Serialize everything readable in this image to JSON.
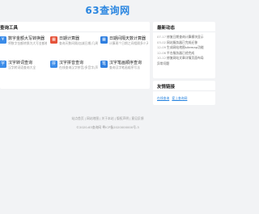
{
  "header": {
    "logo": "63查询网"
  },
  "tools": {
    "title": "查询工具",
    "items": [
      {
        "name": "数字金额大写转换器",
        "desc": "将数字金额转换为大写金额格式",
        "icon": "yuan-icon",
        "icon_char": "¥",
        "color": "#3a8be8"
      },
      {
        "name": "日期计算器",
        "desc": "查询天数间隔/加减日期/几周几",
        "icon": "calendar-icon",
        "icon_char": "▦",
        "color": "#e5533a"
      },
      {
        "name": "日期间隔天数计算器",
        "desc": "计算两个日期之间相隔多少天",
        "icon": "calendar-icon",
        "icon_char": "▦",
        "color": "#2f7fe0"
      },
      {
        "name": "汉字转词查询",
        "desc": "汉字转词语查询大全",
        "icon": "hanzi-icon",
        "icon_char": "字",
        "color": "#3a8be8"
      },
      {
        "name": "汉字拼音查询",
        "desc": "在线查询汉字拼音/多音字/声调大全",
        "icon": "pinyin-icon",
        "icon_char": "拼",
        "color": "#3a8be8"
      },
      {
        "name": "汉字笔画顺序查询",
        "desc": "查询汉字笔画顺序写法",
        "icon": "strokes-icon",
        "icon_char": "笔",
        "color": "#2f7fe0"
      }
    ]
  },
  "news": {
    "title": "最新动态",
    "items": [
      {
        "date": "07-17",
        "text": "修复日期查询计算模块显示"
      },
      {
        "date": "03-02",
        "text": "网站服务器已完成迁移"
      },
      {
        "date": "12-09",
        "text": "生成网站地图sitemap功能"
      },
      {
        "date": "12-06",
        "text": "平台服务器已经完成"
      },
      {
        "date": "10-12",
        "text": "修复网站文章详情页面布局"
      },
      {
        "date": "",
        "text": "异常问题"
      }
    ]
  },
  "friend_links": {
    "title": "友情链接",
    "items": [
      "在线查询",
      "爱上查询网"
    ]
  },
  "footer": {
    "links": [
      "站点首页",
      "网站地图",
      "关于本站",
      "版权声明",
      "意见反馈"
    ],
    "copyright": "©2020-63查询网 粤ICP备2020000000号-3"
  }
}
